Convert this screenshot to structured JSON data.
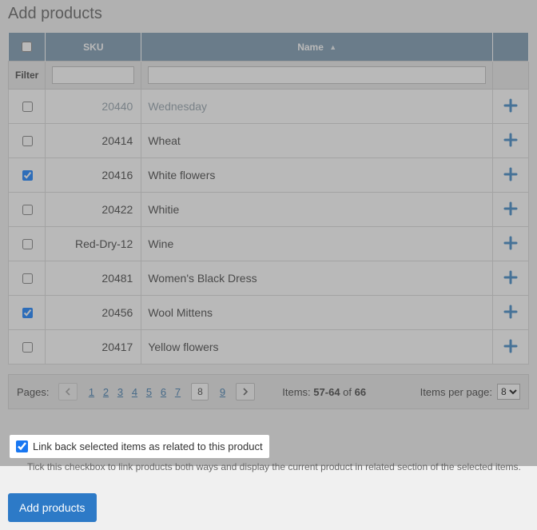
{
  "title": "Add products",
  "columns": {
    "sku": "SKU",
    "name": "Name"
  },
  "filter_label": "Filter",
  "filter_sku_value": "",
  "filter_name_value": "",
  "rows": [
    {
      "checked": false,
      "sku": "20440",
      "name": "Wednesday",
      "disabled": true
    },
    {
      "checked": false,
      "sku": "20414",
      "name": "Wheat",
      "disabled": false
    },
    {
      "checked": true,
      "sku": "20416",
      "name": "White flowers",
      "disabled": false
    },
    {
      "checked": false,
      "sku": "20422",
      "name": "Whitie",
      "disabled": false
    },
    {
      "checked": false,
      "sku": "Red-Dry-12",
      "name": "Wine",
      "disabled": false
    },
    {
      "checked": false,
      "sku": "20481",
      "name": "Women's Black Dress",
      "disabled": false
    },
    {
      "checked": true,
      "sku": "20456",
      "name": "Wool Mittens",
      "disabled": false
    },
    {
      "checked": false,
      "sku": "20417",
      "name": "Yellow flowers",
      "disabled": false
    }
  ],
  "pager": {
    "label": "Pages:",
    "pages": [
      "1",
      "2",
      "3",
      "4",
      "5",
      "6",
      "7"
    ],
    "current": "8",
    "after": [
      "9"
    ],
    "items_label": "Items:",
    "range": "57-64",
    "of_label": "of",
    "total": "66",
    "perpage_label": "Items per page:",
    "perpage_value": "8"
  },
  "linkback": {
    "checked": true,
    "label": "Link back selected items as related to this product",
    "hint": "Tick this checkbox to link products both ways and display the current product in related section of the selected items."
  },
  "submit_label": "Add products"
}
